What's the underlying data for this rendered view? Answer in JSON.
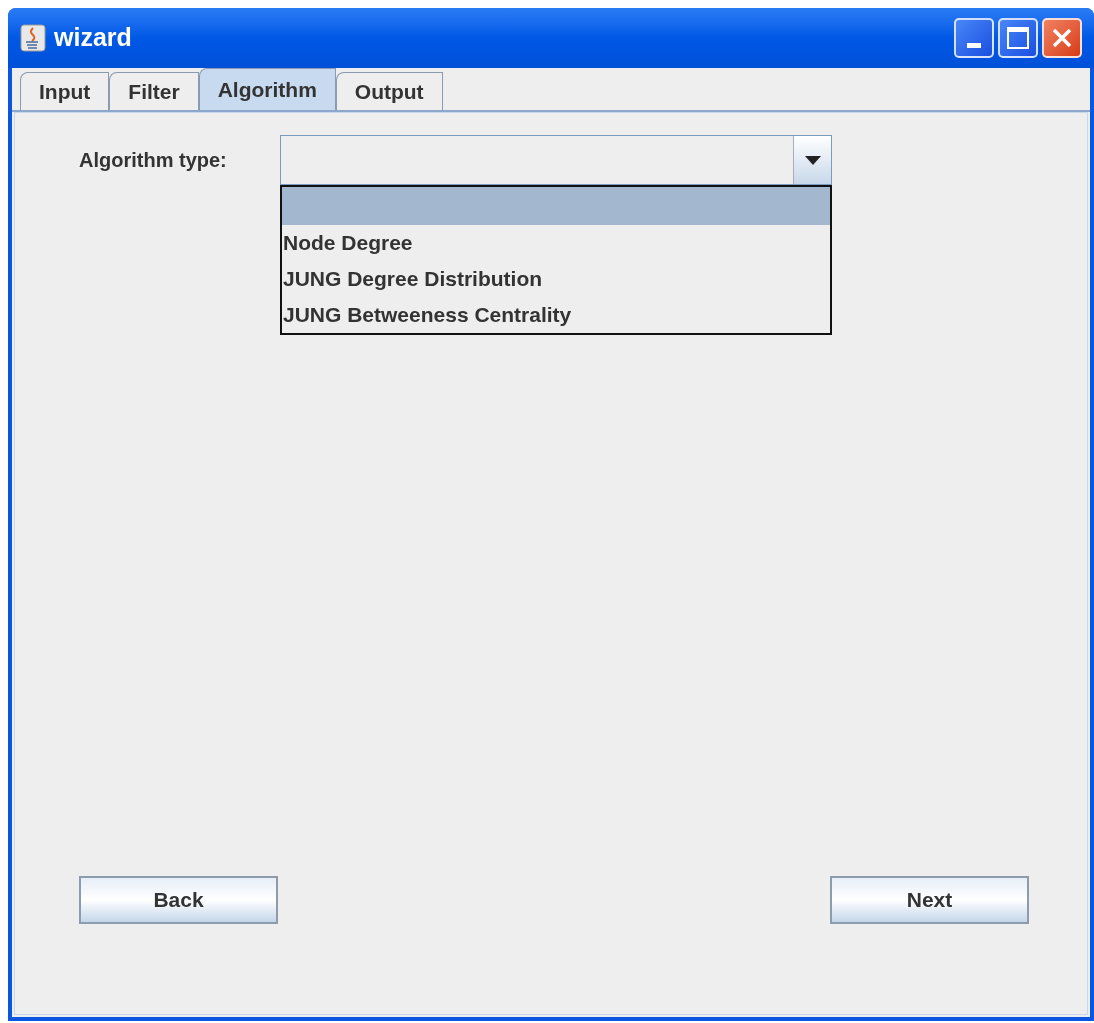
{
  "window": {
    "title": "wizard"
  },
  "tabs": [
    {
      "label": "Input",
      "selected": false
    },
    {
      "label": "Filter",
      "selected": false
    },
    {
      "label": "Algorithm",
      "selected": true
    },
    {
      "label": "Output",
      "selected": false
    }
  ],
  "form": {
    "label": "Algorithm type:",
    "dropdown": {
      "expanded": true,
      "options": [
        {
          "selected": true
        },
        {
          "label": "Node Degree",
          "selected": false
        },
        {
          "label": "JUNG Degree Distribution",
          "selected": false
        },
        {
          "label": "JUNG Betweeness Centrality",
          "selected": false
        }
      ]
    }
  },
  "buttons": [
    {
      "label": "Back"
    },
    {
      "label": "Next"
    }
  ]
}
